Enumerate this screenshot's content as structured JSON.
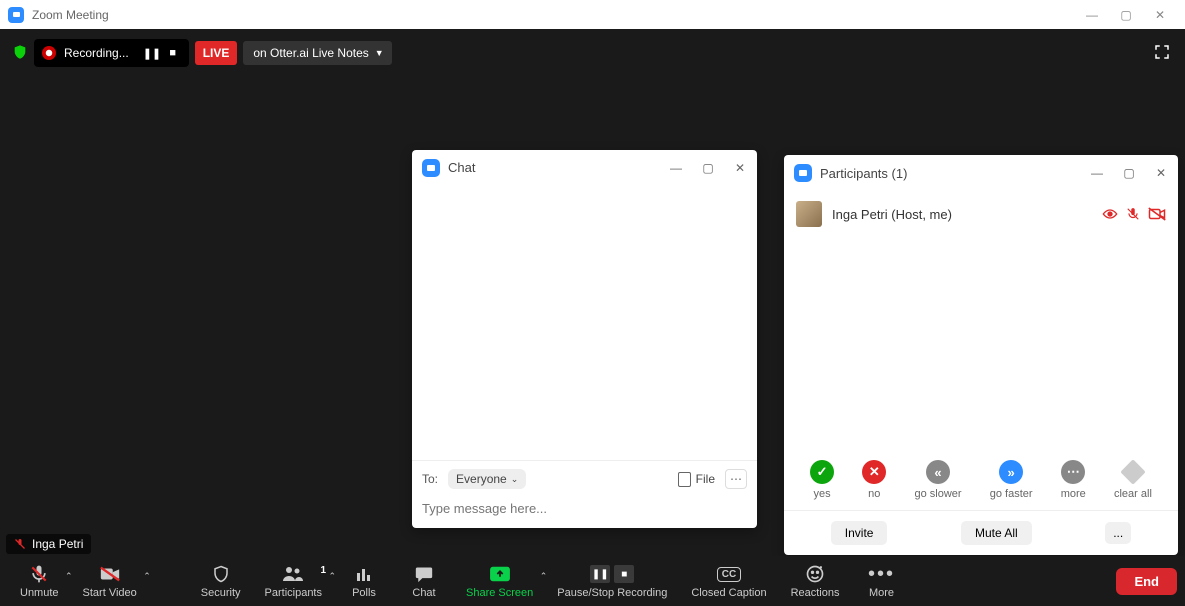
{
  "titlebar": {
    "title": "Zoom Meeting"
  },
  "topbar": {
    "recording_label": "Recording...",
    "live_badge": "LIVE",
    "live_dest": "on Otter.ai Live Notes"
  },
  "chat": {
    "title": "Chat",
    "to_label": "To:",
    "to_value": "Everyone",
    "file_label": "File",
    "input_placeholder": "Type message here..."
  },
  "participants": {
    "title": "Participants (1)",
    "items": [
      {
        "name": "Inga Petri (Host, me)"
      }
    ],
    "reactions": {
      "yes": "yes",
      "no": "no",
      "slower": "go slower",
      "faster": "go faster",
      "more": "more",
      "clear": "clear all"
    },
    "invite": "Invite",
    "mute_all": "Mute All",
    "footer_more": "..."
  },
  "overlay": {
    "name": "Inga Petri"
  },
  "controls": {
    "unmute": "Unmute",
    "start_video": "Start Video",
    "security": "Security",
    "participants": "Participants",
    "participants_count": "1",
    "polls": "Polls",
    "chat": "Chat",
    "share_screen": "Share Screen",
    "pause_stop": "Pause/Stop Recording",
    "closed_caption": "Closed Caption",
    "reactions": "Reactions",
    "more": "More",
    "end": "End"
  }
}
